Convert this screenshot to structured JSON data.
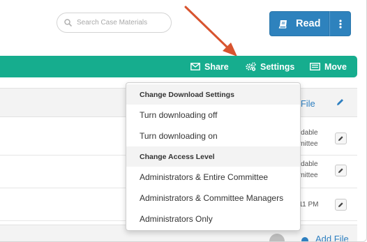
{
  "search": {
    "placeholder": "Search Case Materials",
    "icon": "search-icon"
  },
  "read_button": {
    "label": "Read",
    "icon": "book-icon"
  },
  "more_button": {
    "icon": "vertical-dots-icon"
  },
  "toolbar": {
    "share_label": "Share",
    "settings_label": "Settings",
    "move_label": "Move",
    "accent_color": "#16ad8e"
  },
  "background": {
    "add_file_label": "d File",
    "row1_status": [
      "oadable",
      "mmittee"
    ],
    "row2_status": [
      "oadable",
      "mmittee"
    ],
    "row3_status": "4:11 PM",
    "add_file_bottom_label": "Add File"
  },
  "dropdown": {
    "download_header": "Change Download Settings",
    "download_items": [
      "Turn downloading off",
      "Turn downloading on"
    ],
    "access_header": "Change Access Level",
    "access_items": [
      "Administrators & Entire Committee",
      "Administrators & Committee Managers",
      "Administrators Only"
    ]
  },
  "colors": {
    "primary_blue": "#2e82bd",
    "annotation_arrow": "#d8542f"
  }
}
